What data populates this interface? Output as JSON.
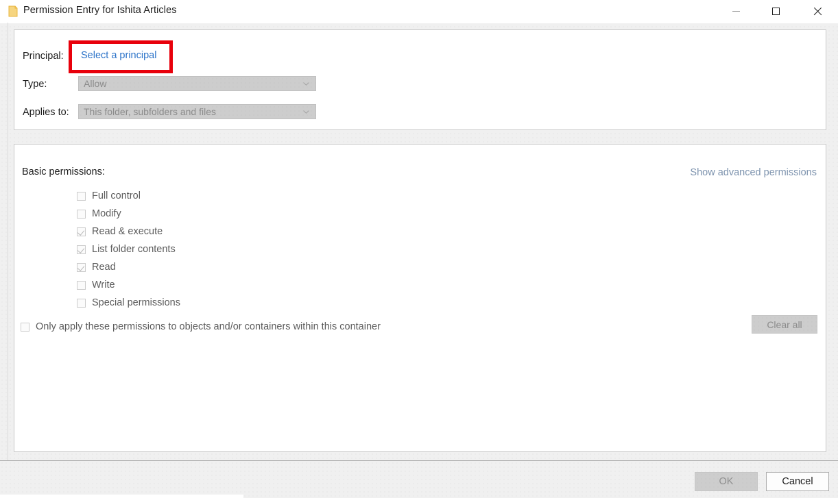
{
  "window": {
    "title": "Permission Entry for Ishita Articles",
    "icon": "folder-icon",
    "controls": {
      "minimize": "minimize-icon",
      "maximize": "maximize-icon",
      "close": "close-icon"
    }
  },
  "principal_section": {
    "principal_label": "Principal:",
    "principal_link": "Select a principal",
    "type_label": "Type:",
    "type_value": "Allow",
    "applies_label": "Applies to:",
    "applies_value": "This folder, subfolders and files"
  },
  "permissions_section": {
    "heading": "Basic permissions:",
    "advanced_link": "Show advanced permissions",
    "items": [
      {
        "label": "Full control",
        "checked": false
      },
      {
        "label": "Modify",
        "checked": false
      },
      {
        "label": "Read & execute",
        "checked": true
      },
      {
        "label": "List folder contents",
        "checked": true
      },
      {
        "label": "Read",
        "checked": true
      },
      {
        "label": "Write",
        "checked": false
      },
      {
        "label": "Special permissions",
        "checked": false
      }
    ],
    "only_apply_label": "Only apply these permissions to objects and/or containers within this container",
    "only_apply_checked": false,
    "clear_all_label": "Clear all"
  },
  "footer": {
    "ok_label": "OK",
    "cancel_label": "Cancel"
  },
  "colors": {
    "link": "#2a72c8",
    "advanced_link": "#7d93ae",
    "highlight": "#e8000b",
    "disabled_text": "#8b8b8b",
    "body_text": "#5c5c5c",
    "label_text": "#1b1b1b"
  }
}
